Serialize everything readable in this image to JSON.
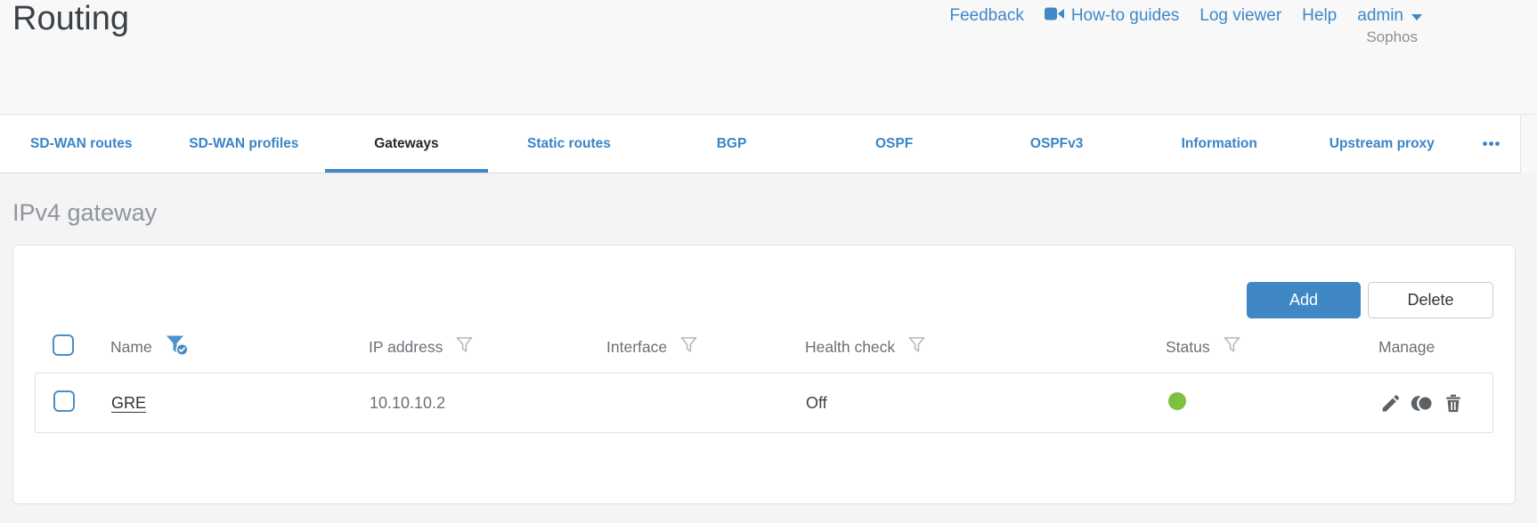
{
  "header": {
    "title": "Routing",
    "brand": "Sophos",
    "nav": [
      {
        "label": "Feedback"
      },
      {
        "label": "How-to guides",
        "icon": "video-camera-icon"
      },
      {
        "label": "Log viewer"
      },
      {
        "label": "Help"
      },
      {
        "label": "admin",
        "icon": "caret-down-icon"
      }
    ]
  },
  "tabs": {
    "items": [
      {
        "label": "SD-WAN routes",
        "active": false
      },
      {
        "label": "SD-WAN profiles",
        "active": false
      },
      {
        "label": "Gateways",
        "active": true
      },
      {
        "label": "Static routes",
        "active": false
      },
      {
        "label": "BGP",
        "active": false
      },
      {
        "label": "OSPF",
        "active": false
      },
      {
        "label": "OSPFv3",
        "active": false
      },
      {
        "label": "Information",
        "active": false
      },
      {
        "label": "Upstream proxy",
        "active": false
      }
    ],
    "more_label": "•••"
  },
  "content": {
    "section_heading": "IPv4 gateway"
  },
  "toolbar": {
    "add_label": "Add",
    "delete_label": "Delete"
  },
  "table": {
    "columns": [
      {
        "label": "Name",
        "filter": "active"
      },
      {
        "label": "IP address",
        "filter": "default"
      },
      {
        "label": "Interface",
        "filter": "default"
      },
      {
        "label": "Health check",
        "filter": "default"
      },
      {
        "label": "Status",
        "filter": "default"
      },
      {
        "label": "Manage",
        "filter": "none"
      }
    ],
    "rows": [
      {
        "name": "GRE",
        "ip_address": "10.10.10.2",
        "interface": "",
        "health_check": "Off",
        "status": "up",
        "manage_actions": [
          "edit",
          "clone",
          "delete"
        ]
      }
    ]
  },
  "colors": {
    "accent_blue": "#3f87c5",
    "status_up_green": "#7dc142",
    "title_text": "#3a4148",
    "section_heading_text": "#8e959c",
    "header_background": "#f8f8f9",
    "content_background": "#f4f4f5"
  }
}
